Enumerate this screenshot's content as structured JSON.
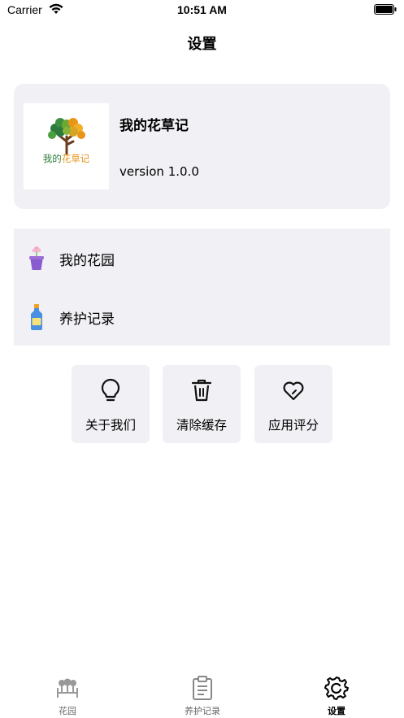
{
  "status_bar": {
    "carrier": "Carrier",
    "time": "10:51 AM"
  },
  "nav": {
    "title": "设置"
  },
  "app_info": {
    "logo_text_part1": "我的",
    "logo_text_part2": "花草记",
    "name": "我的花草记",
    "version": "version 1.0.0"
  },
  "menu": {
    "items": [
      {
        "label": "我的花园",
        "icon": "flower-pot-icon"
      },
      {
        "label": "养护记录",
        "icon": "bottle-icon"
      }
    ]
  },
  "actions": [
    {
      "label": "关于我们",
      "icon": "lightbulb-icon"
    },
    {
      "label": "清除缓存",
      "icon": "trash-icon"
    },
    {
      "label": "应用评分",
      "icon": "heart-icon"
    }
  ],
  "tabs": [
    {
      "label": "花园",
      "icon": "garden-icon",
      "active": false
    },
    {
      "label": "养护记录",
      "icon": "clipboard-icon",
      "active": false
    },
    {
      "label": "设置",
      "icon": "gear-icon",
      "active": true
    }
  ],
  "colors": {
    "card_bg": "#f1f1f5",
    "logo_green": "#2c7a3b",
    "logo_orange": "#e8951a",
    "inactive_tab": "#666666"
  }
}
